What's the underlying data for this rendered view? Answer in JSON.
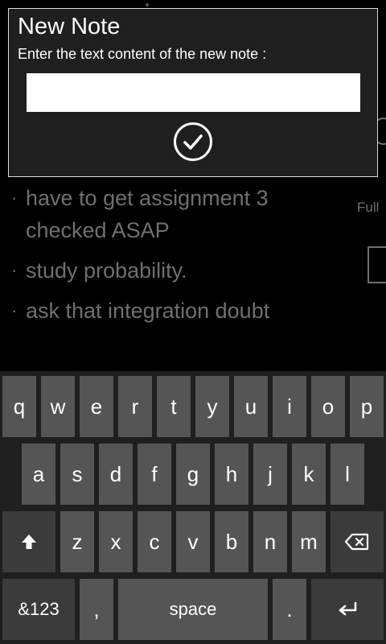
{
  "dialog": {
    "title": "New Note",
    "prompt": "Enter the text content of the new note :",
    "input_value": "",
    "confirm_icon": "check-circle-icon"
  },
  "background": {
    "notes": [
      "have to get assignment 3 checked ASAP",
      "study probability.",
      "ask that integration doubt"
    ],
    "bullet": "·",
    "side_label": "Full"
  },
  "keyboard": {
    "row1": [
      "q",
      "w",
      "e",
      "r",
      "t",
      "y",
      "u",
      "i",
      "o",
      "p"
    ],
    "row2": [
      "a",
      "s",
      "d",
      "f",
      "g",
      "h",
      "j",
      "k",
      "l"
    ],
    "row3": [
      "z",
      "x",
      "c",
      "v",
      "b",
      "n",
      "m"
    ],
    "shift_icon": "shift-arrow-icon",
    "backspace_icon": "backspace-icon",
    "symbols_label": "&123",
    "comma_label": ",",
    "space_label": "space",
    "period_label": ".",
    "enter_icon": "enter-icon"
  },
  "colors": {
    "background": "#000000",
    "dialog_bg": "#1f1f1f",
    "dialog_border": "#dcdcdc",
    "key_light": "#555555",
    "key_dark": "#3b3b3b",
    "dimmed_text": "#6f6f6f"
  }
}
